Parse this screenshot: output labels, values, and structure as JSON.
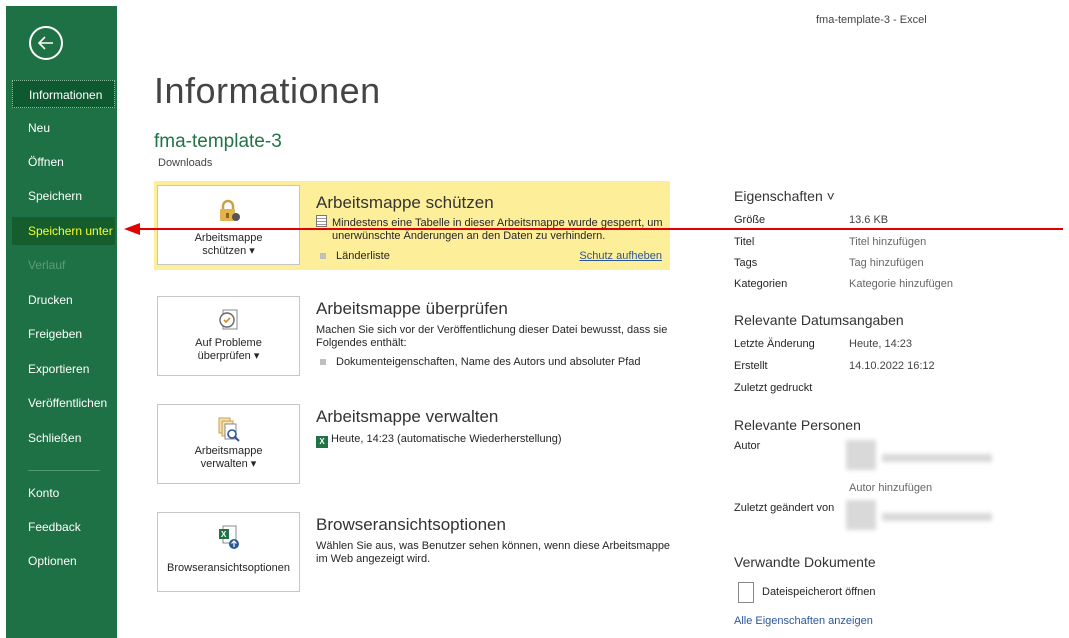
{
  "window": {
    "title": "fma-template-3  -  Excel"
  },
  "nav": {
    "informationen": "Informationen",
    "neu": "Neu",
    "oeffnen": "Öffnen",
    "speichern": "Speichern",
    "speichern_unter": "Speichern unter",
    "verlauf": "Verlauf",
    "drucken": "Drucken",
    "freigeben": "Freigeben",
    "exportieren": "Exportieren",
    "veroeffentlichen": "Veröffentlichen",
    "schliessen": "Schließen",
    "konto": "Konto",
    "feedback": "Feedback",
    "optionen": "Optionen"
  },
  "page": {
    "title": "Informationen",
    "file_name": "fma-template-3",
    "location": "Downloads"
  },
  "protect": {
    "button_line1": "Arbeitsmappe",
    "button_line2": "schützen ▾",
    "title": "Arbeitsmappe schützen",
    "text1": "Mindestens eine Tabelle in dieser Arbeitsmappe wurde gesperrt, um",
    "text2": "unerwünschte Änderungen an den Daten zu verhindern.",
    "item": "Länderliste",
    "unprotect_link": "Schutz aufheben"
  },
  "inspect": {
    "button_line1": "Auf Probleme",
    "button_line2": "überprüfen ▾",
    "title": "Arbeitsmappe überprüfen",
    "text1": "Machen Sie sich vor der Veröffentlichung dieser Datei bewusst, dass sie",
    "text2": "Folgendes enthält:",
    "item": "Dokumenteigenschaften, Name des Autors und absoluter Pfad"
  },
  "manage": {
    "button_line1": "Arbeitsmappe",
    "button_line2": "verwalten ▾",
    "title": "Arbeitsmappe verwalten",
    "item": "Heute, 14:23 (automatische Wiederherstellung)"
  },
  "browser": {
    "button_label": "Browseransichtsoptionen",
    "title": "Browseransichtsoptionen",
    "text1": "Wählen Sie aus, was Benutzer sehen können, wenn diese Arbeitsmappe",
    "text2": "im Web angezeigt wird."
  },
  "properties": {
    "header": "Eigenschaften ˅",
    "groesse_label": "Größe",
    "groesse_value": "13.6 KB",
    "titel_label": "Titel",
    "titel_value": "Titel hinzufügen",
    "tags_label": "Tags",
    "tags_value": "Tag hinzufügen",
    "kategorien_label": "Kategorien",
    "kategorien_value": "Kategorie hinzufügen",
    "dates_header": "Relevante Datumsangaben",
    "modified_label": "Letzte Änderung",
    "modified_value": "Heute, 14:23",
    "created_label": "Erstellt",
    "created_value": "14.10.2022 16:12",
    "printed_label": "Zuletzt gedruckt",
    "people_header": "Relevante Personen",
    "author_label": "Autor",
    "add_author": "Autor hinzufügen",
    "last_modified_by_label": "Zuletzt geändert von",
    "related_header": "Verwandte Dokumente",
    "open_location": "Dateispeicherort öffnen",
    "show_all": "Alle Eigenschaften anzeigen"
  },
  "colors": {
    "sidebar": "#1e7145",
    "accent": "#217346",
    "highlight": "#f4ff2a",
    "arrow": "#e00000",
    "protect_bg": "#fdee9a"
  }
}
